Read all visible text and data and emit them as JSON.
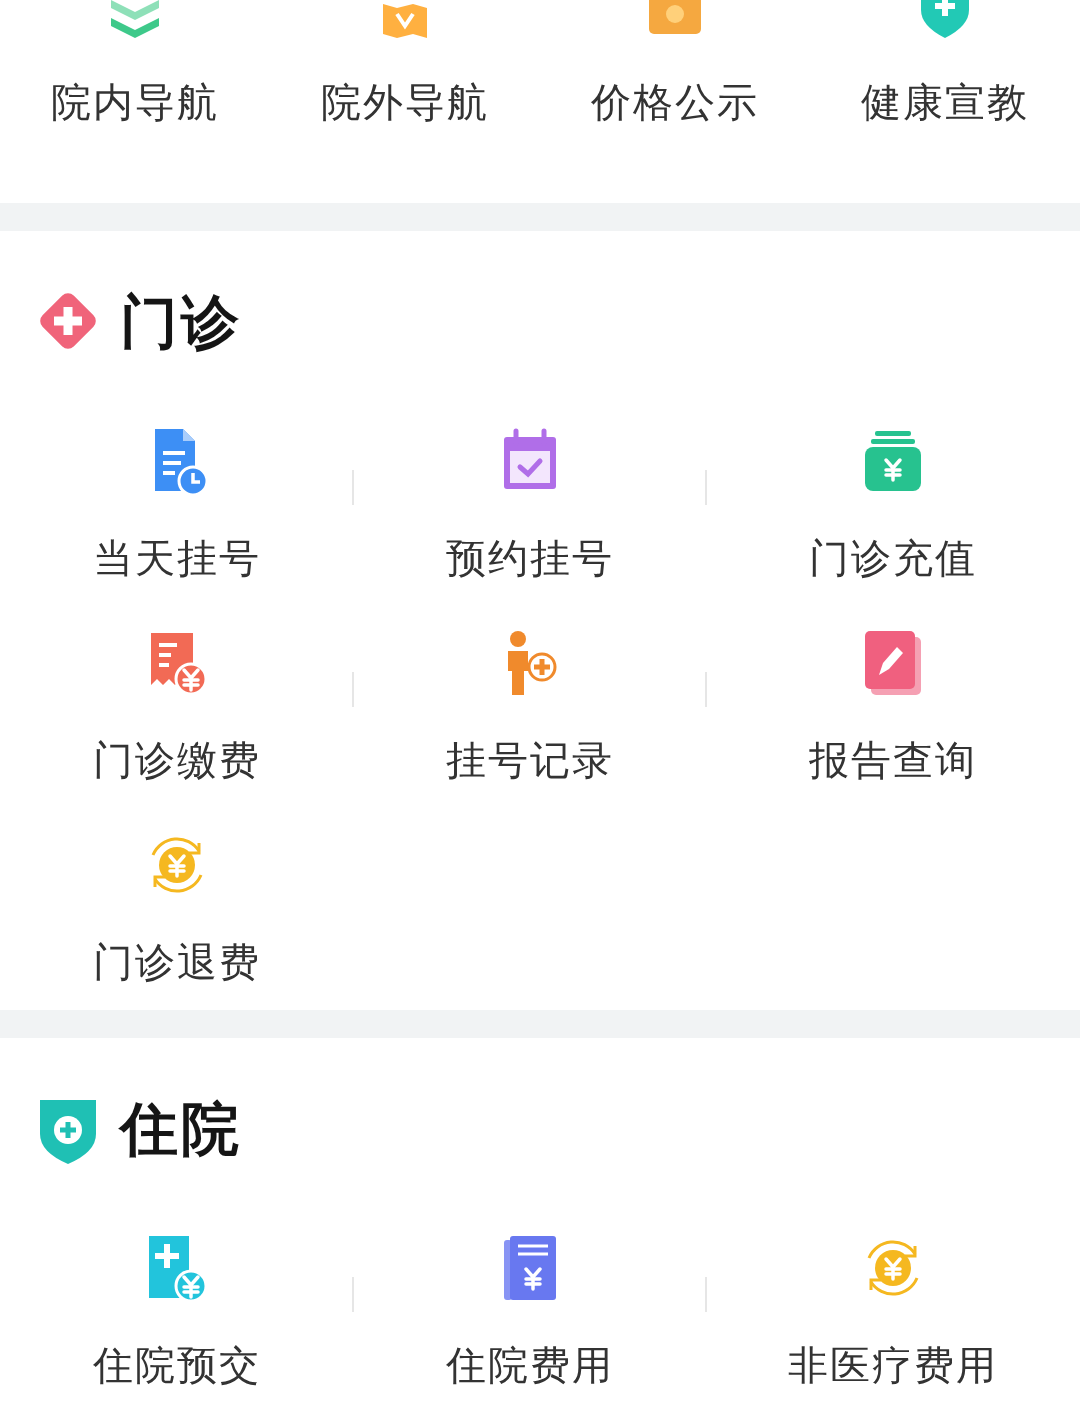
{
  "quick_links": [
    {
      "label": "院内导航"
    },
    {
      "label": "院外导航"
    },
    {
      "label": "价格公示"
    },
    {
      "label": "健康宣教"
    }
  ],
  "sections": [
    {
      "title": "门诊",
      "items": [
        {
          "label": "当天挂号"
        },
        {
          "label": "预约挂号"
        },
        {
          "label": "门诊充值"
        },
        {
          "label": "门诊缴费"
        },
        {
          "label": "挂号记录"
        },
        {
          "label": "报告查询"
        },
        {
          "label": "门诊退费"
        }
      ]
    },
    {
      "title": "住院",
      "items": [
        {
          "label": "住院预交"
        },
        {
          "label": "住院费用"
        },
        {
          "label": "非医疗费用"
        }
      ]
    }
  ]
}
